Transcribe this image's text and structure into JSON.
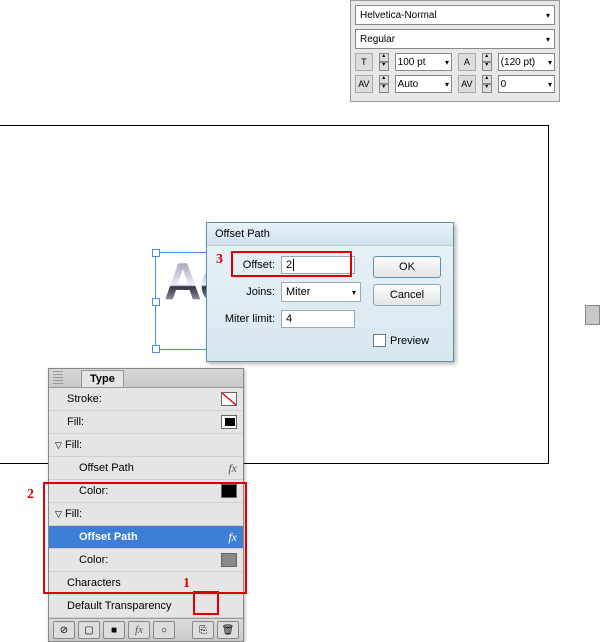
{
  "charPanel": {
    "fontName": "Helvetica-Normal",
    "fontStyle": "Regular",
    "size": "100 pt",
    "leading": "(120 pt)",
    "kerning": "Auto",
    "tracking": "0"
  },
  "artText": "Ad",
  "dialog": {
    "title": "Offset Path",
    "offsetLabel": "Offset:",
    "offsetValue": "2",
    "joinsLabel": "Joins:",
    "joinsValue": "Miter",
    "miterLabel": "Miter limit:",
    "miterValue": "4",
    "ok": "OK",
    "cancel": "Cancel",
    "preview": "Preview"
  },
  "appearance": {
    "tab": "Type",
    "stroke": "Stroke:",
    "fill": "Fill:",
    "fillHeader": "Fill:",
    "offsetPath": "Offset Path",
    "color": "Color:",
    "characters": "Characters",
    "defaultTrans": "Default Transparency"
  },
  "annotations": {
    "n1": "1",
    "n2": "2",
    "n3": "3"
  }
}
